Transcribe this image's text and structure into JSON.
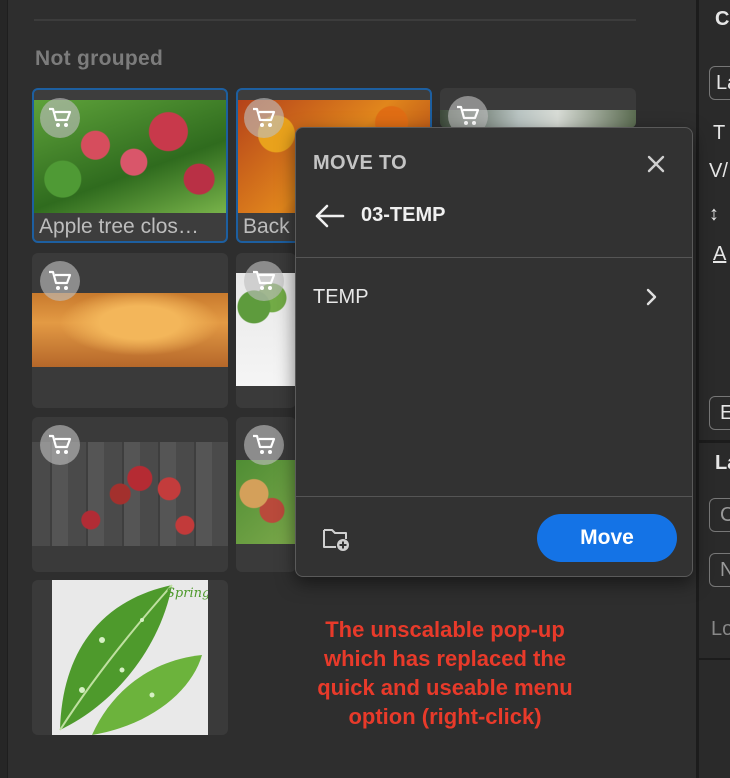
{
  "library": {
    "group_heading": "Not grouped",
    "items": [
      {
        "caption": "Apple tree clos…",
        "selected": true
      },
      {
        "caption": "Back",
        "selected": true
      },
      {
        "caption": "",
        "selected": false
      },
      {
        "caption": "",
        "selected": false
      },
      {
        "caption": "",
        "selected": false
      },
      {
        "caption": "",
        "selected": false
      },
      {
        "caption": "",
        "selected": false
      },
      {
        "caption": "",
        "selected": false
      }
    ],
    "spring_text": "Spring"
  },
  "right_panel": {
    "header": "Cl",
    "field_value": "La",
    "text_tools": [
      "T",
      "V/",
      "↕",
      "A"
    ],
    "button_label": "E",
    "section_label": "La",
    "field2": "C",
    "field3": "N",
    "field4": "Lo"
  },
  "move_dialog": {
    "title": "MOVE TO",
    "current_folder": "03-TEMP",
    "folders": [
      {
        "label": "TEMP"
      }
    ],
    "move_button": "Move"
  },
  "annotation": "The unscalable pop-up which has replaced the quick and useable menu option (right-click)",
  "colors": {
    "accent": "#1473e6",
    "annotation": "#e83a2a",
    "selection_border": "#1d5fa0"
  },
  "icons": [
    "cart-icon",
    "close-icon",
    "arrow-left-icon",
    "chevron-right-icon",
    "new-folder-icon"
  ]
}
